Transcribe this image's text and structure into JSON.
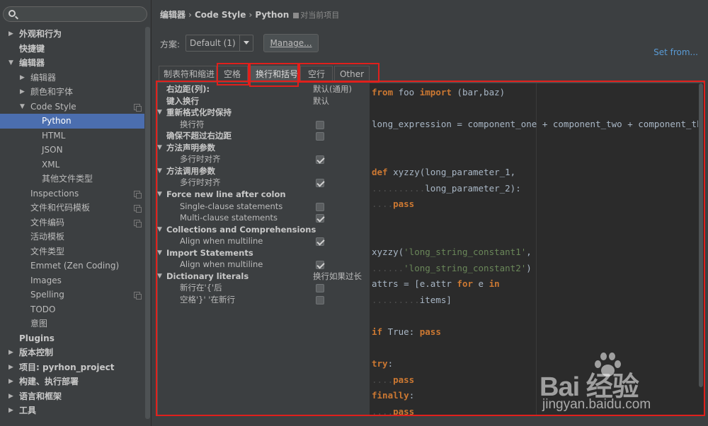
{
  "sidebar": {
    "items": [
      {
        "label": "外观和行为",
        "indent": 1,
        "arrow": "right",
        "bold": true
      },
      {
        "label": "快捷键",
        "indent": 1,
        "arrow": "",
        "bold": true
      },
      {
        "label": "编辑器",
        "indent": 1,
        "arrow": "down",
        "bold": true
      },
      {
        "label": "编辑器",
        "indent": 2,
        "arrow": "right",
        "bold": false
      },
      {
        "label": "颜色和字体",
        "indent": 2,
        "arrow": "right",
        "bold": false
      },
      {
        "label": "Code Style",
        "indent": 2,
        "arrow": "down",
        "bold": false,
        "copy": true
      },
      {
        "label": "Python",
        "indent": 3,
        "arrow": "",
        "bold": false,
        "selected": true
      },
      {
        "label": "HTML",
        "indent": 3,
        "arrow": "",
        "bold": false
      },
      {
        "label": "JSON",
        "indent": 3,
        "arrow": "",
        "bold": false
      },
      {
        "label": "XML",
        "indent": 3,
        "arrow": "",
        "bold": false
      },
      {
        "label": "其他文件类型",
        "indent": 3,
        "arrow": "",
        "bold": false
      },
      {
        "label": "Inspections",
        "indent": 2,
        "arrow": "",
        "bold": false,
        "copy": true
      },
      {
        "label": "文件和代码模板",
        "indent": 2,
        "arrow": "",
        "bold": false,
        "copy": true
      },
      {
        "label": "文件编码",
        "indent": 2,
        "arrow": "",
        "bold": false,
        "copy": true
      },
      {
        "label": "活动模板",
        "indent": 2,
        "arrow": "",
        "bold": false
      },
      {
        "label": "文件类型",
        "indent": 2,
        "arrow": "",
        "bold": false
      },
      {
        "label": "Emmet (Zen Coding)",
        "indent": 2,
        "arrow": "",
        "bold": false
      },
      {
        "label": "Images",
        "indent": 2,
        "arrow": "",
        "bold": false
      },
      {
        "label": "Spelling",
        "indent": 2,
        "arrow": "",
        "bold": false,
        "copy": true
      },
      {
        "label": "TODO",
        "indent": 2,
        "arrow": "",
        "bold": false
      },
      {
        "label": "意图",
        "indent": 2,
        "arrow": "",
        "bold": false
      },
      {
        "label": "Plugins",
        "indent": 1,
        "arrow": "",
        "bold": true
      },
      {
        "label": "版本控制",
        "indent": 1,
        "arrow": "right",
        "bold": true
      },
      {
        "label": "项目: pyrhon_project",
        "indent": 1,
        "arrow": "right",
        "bold": true
      },
      {
        "label": "构建、执行部署",
        "indent": 1,
        "arrow": "right",
        "bold": true
      },
      {
        "label": "语言和框架",
        "indent": 1,
        "arrow": "right",
        "bold": true
      },
      {
        "label": "工具",
        "indent": 1,
        "arrow": "right",
        "bold": true
      }
    ]
  },
  "breadcrumb": {
    "part1": "编辑器",
    "part2": "Code Style",
    "part3": "Python",
    "note": "对当前项目"
  },
  "scheme": {
    "label": "方案:",
    "value": "Default (1)",
    "manage_label": "Manage...",
    "set_from": "Set from..."
  },
  "tabs": [
    {
      "label": "制表符和缩进",
      "active": false
    },
    {
      "label": "空格",
      "active": false
    },
    {
      "label": "换行和括号",
      "active": true
    },
    {
      "label": "空行",
      "active": false
    },
    {
      "label": "Other",
      "active": false
    }
  ],
  "options": [
    {
      "label": "右边距(列):",
      "head": true,
      "tri": false,
      "level": 0,
      "value": "默认(通用)"
    },
    {
      "label": "键入换行",
      "head": true,
      "tri": false,
      "level": 0,
      "value": "默认"
    },
    {
      "label": "重新格式化时保持",
      "head": true,
      "tri": true,
      "level": 0
    },
    {
      "label": "换行符",
      "head": false,
      "tri": false,
      "level": 1,
      "checked": false
    },
    {
      "label": "确保不超过右边距",
      "head": true,
      "tri": false,
      "level": 0,
      "checked": false
    },
    {
      "label": "方法声明参数",
      "head": true,
      "tri": true,
      "level": 0
    },
    {
      "label": "多行时对齐",
      "head": false,
      "tri": false,
      "level": 1,
      "checked": true
    },
    {
      "label": "方法调用参数",
      "head": true,
      "tri": true,
      "level": 0
    },
    {
      "label": "多行时对齐",
      "head": false,
      "tri": false,
      "level": 1,
      "checked": true
    },
    {
      "label": "Force new line after colon",
      "head": true,
      "tri": true,
      "level": 0
    },
    {
      "label": "Single-clause statements",
      "head": false,
      "tri": false,
      "level": 1,
      "checked": false
    },
    {
      "label": "Multi-clause statements",
      "head": false,
      "tri": false,
      "level": 1,
      "checked": true
    },
    {
      "label": "Collections and Comprehensions",
      "head": true,
      "tri": true,
      "level": 0
    },
    {
      "label": "Align when multiline",
      "head": false,
      "tri": false,
      "level": 1,
      "checked": true
    },
    {
      "label": "Import Statements",
      "head": true,
      "tri": true,
      "level": 0
    },
    {
      "label": "Align when multiline",
      "head": false,
      "tri": false,
      "level": 1,
      "checked": true
    },
    {
      "label": "Dictionary literals",
      "head": true,
      "tri": true,
      "level": 0,
      "value": "换行如果过长"
    },
    {
      "label": "新行在'{'后",
      "head": false,
      "tri": false,
      "level": 1,
      "checked": false
    },
    {
      "label": "空格'}' '在新行",
      "head": false,
      "tri": false,
      "level": 1,
      "checked": false
    }
  ],
  "code": {
    "lines": [
      [
        [
          "kw",
          "from"
        ],
        [
          "pl",
          " foo "
        ],
        [
          "kw",
          "import"
        ],
        [
          "pl",
          " (bar,baz)"
        ]
      ],
      [],
      [
        [
          "pl",
          "long_expression = component_one + component_two + component_three"
        ]
      ],
      [],
      [],
      [
        [
          "kw",
          "def"
        ],
        [
          "pl",
          " xyzzy(long_parameter_1,"
        ]
      ],
      [
        [
          "dots",
          ".........."
        ],
        [
          "pl",
          "long_parameter_2):"
        ]
      ],
      [
        [
          "dots",
          "...."
        ],
        [
          "kw",
          "pass"
        ]
      ],
      [],
      [],
      [
        [
          "pl",
          "xyzzy("
        ],
        [
          "str",
          "'long_string_constant1'"
        ],
        [
          "pl",
          ","
        ]
      ],
      [
        [
          "dots",
          "......"
        ],
        [
          "str",
          "'long_string_constant2'"
        ],
        [
          "pl",
          ")"
        ]
      ],
      [
        [
          "pl",
          "attrs = [e.attr "
        ],
        [
          "kw",
          "for"
        ],
        [
          "pl",
          " e "
        ],
        [
          "kw",
          "in"
        ]
      ],
      [
        [
          "dots",
          "........."
        ],
        [
          "pl",
          "items]"
        ]
      ],
      [],
      [
        [
          "kw",
          "if"
        ],
        [
          "pl",
          " True: "
        ],
        [
          "kw",
          "pass"
        ]
      ],
      [],
      [
        [
          "kw",
          "try"
        ],
        [
          "pl",
          ":"
        ]
      ],
      [
        [
          "dots",
          "...."
        ],
        [
          "kw",
          "pass"
        ]
      ],
      [
        [
          "kw",
          "finally"
        ],
        [
          "pl",
          ":"
        ]
      ],
      [
        [
          "dots",
          "...."
        ],
        [
          "kw",
          "pass"
        ]
      ]
    ]
  },
  "watermark": {
    "logo": "Bai  经验",
    "url": "jingyan.baidu.com"
  }
}
